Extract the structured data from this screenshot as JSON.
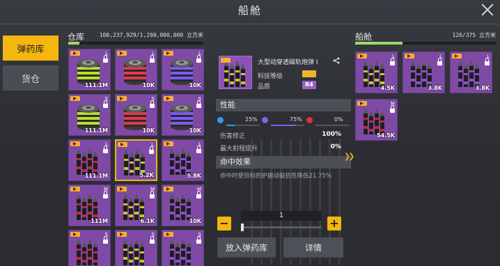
{
  "title": "船舱",
  "nav": [
    {
      "label": "弹药库",
      "active": true
    },
    {
      "label": "货仓",
      "active": false
    }
  ],
  "warehouse": {
    "label": "仓库",
    "capacity": "100,237,929/1,200,000,000 立方米",
    "fill_fraction": 0.08,
    "items": [
      {
        "type": "canister",
        "color": "#b6e12b",
        "size": "L",
        "qty": "111.1M"
      },
      {
        "type": "canister",
        "color": "#e23a4a",
        "size": "L",
        "qty": "10K"
      },
      {
        "type": "canister",
        "color": "#7b5cff",
        "size": "L",
        "qty": "10K"
      },
      {
        "type": "canister",
        "color": "#b6e12b",
        "size": "S",
        "qty": "111.1M"
      },
      {
        "type": "canister",
        "color": "#e23a4a",
        "size": "S",
        "qty": "10K"
      },
      {
        "type": "canister",
        "color": "#7b5cff",
        "size": "S",
        "qty": "10K"
      },
      {
        "type": "shells",
        "color": "#c02a3c",
        "size": "L",
        "qty": "111.1M"
      },
      {
        "type": "shells",
        "color": "#c9c32a",
        "size": "L",
        "qty": "5.2K",
        "selected": true
      },
      {
        "type": "shells",
        "color": "#8b4fd0",
        "size": "L",
        "qty": "5.8K"
      },
      {
        "type": "shells",
        "color": "#c02a3c",
        "size": "M",
        "qty": "111M"
      },
      {
        "type": "shells",
        "color": "#c9c32a",
        "size": "M",
        "qty": "6.1K"
      },
      {
        "type": "shells",
        "color": "#8b4fd0",
        "size": "M",
        "qty": "10K"
      },
      {
        "type": "shells",
        "color": "#c02a3c",
        "size": "S",
        "qty": ""
      },
      {
        "type": "shells",
        "color": "#c9c32a",
        "size": "S",
        "qty": ""
      },
      {
        "type": "shells",
        "color": "#8b4fd0",
        "size": "S",
        "qty": ""
      }
    ]
  },
  "detail": {
    "name": "大型动穿透磁轨炮弹 I",
    "tech_label": "科技等级",
    "quality_label": "品质",
    "quality": "R4",
    "perf_label": "性能",
    "stats": [
      {
        "value": "25%",
        "color": "#2e9bff",
        "fraction": 0.25
      },
      {
        "value": "75%",
        "color": "#8a5cf0",
        "fraction": 0.75
      },
      {
        "value": "0%",
        "color": "#e0303a",
        "fraction": 0
      }
    ],
    "props": [
      {
        "label": "伤害修正",
        "value": "100%"
      },
      {
        "label": "最大射程提升",
        "value": "0%"
      }
    ],
    "effect_label": "命中效果",
    "effect_text": "命中时使目标的护盾动能抗性降低21.75%",
    "quantity": "1",
    "quantity_fraction": 0,
    "minus": "−",
    "plus": "+",
    "btn_put": "放入弹药库",
    "btn_info": "详情"
  },
  "ship": {
    "label": "船舱",
    "capacity": "126/375 立方米",
    "fill_fraction": 0.336,
    "items": [
      {
        "type": "shells",
        "color": "#c9c32a",
        "size": "L",
        "qty": "4.5K"
      },
      {
        "type": "shells",
        "color": "#8b4fd0",
        "size": "L",
        "qty": "3.8K"
      },
      {
        "type": "shells",
        "color": "#8b4fd0",
        "size": "L",
        "qty": "3.8K"
      },
      {
        "type": "shells",
        "color": "#c02a3c",
        "size": "M",
        "qty": "54.5K"
      }
    ]
  },
  "colors": {
    "accent": "#f5b70f",
    "item_bg": "#7f4aa6",
    "cap_bar": "#9fd86d"
  }
}
